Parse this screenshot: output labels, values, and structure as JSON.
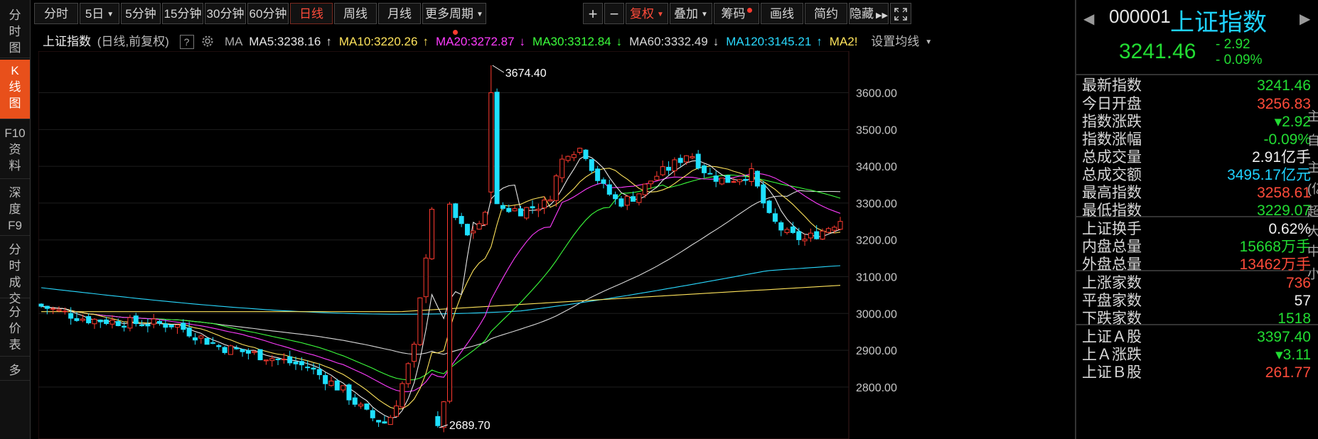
{
  "leftnav": [
    {
      "label": [
        "分",
        "时",
        "图"
      ],
      "active": false
    },
    {
      "label": [
        "K",
        "线",
        "图"
      ],
      "active": true
    },
    {
      "label": [
        "F10",
        "资",
        "料"
      ],
      "active": false
    },
    {
      "label": [
        "深",
        "度",
        "F9"
      ],
      "active": false
    },
    {
      "label": [
        "分",
        "时",
        "成",
        "交"
      ],
      "active": false
    },
    {
      "label": [
        "分",
        "价",
        "表"
      ],
      "active": false
    },
    {
      "label": [
        "多"
      ],
      "active": false
    }
  ],
  "toolbar": {
    "intraday": "分时",
    "five_day": "5日",
    "m5": "5分钟",
    "m15": "15分钟",
    "m30": "30分钟",
    "m60": "60分钟",
    "daily": "日线",
    "weekly": "周线",
    "monthly": "月线",
    "more_period": "更多周期",
    "plus": "+",
    "minus": "−",
    "adjust": "复权",
    "overlay": "叠加",
    "chips": "筹码",
    "draw": "画线",
    "simple": "简约",
    "hide": "隐藏",
    "fullscreen_icon": "fullscreen-icon",
    "caret_icon": "chevron-down-icon"
  },
  "legend": {
    "name": "上证指数",
    "desc": "(日线,前复权)",
    "help": "?",
    "gear_icon": "gear-icon",
    "ma": "MA",
    "items": [
      {
        "text": "MA5:3238.16",
        "arrow": "↑",
        "color": "#e8e8e8"
      },
      {
        "text": "MA10:3220.26",
        "arrow": "↑",
        "color": "#ffe45c"
      },
      {
        "text": "MA20:3272.87",
        "arrow": "↓",
        "color": "#ff3cff"
      },
      {
        "text": "MA30:3312.84",
        "arrow": "↓",
        "color": "#3cff3c"
      },
      {
        "text": "MA60:3332.49",
        "arrow": "↓",
        "color": "#d8d8d8"
      },
      {
        "text": "MA120:3145.21",
        "arrow": "↑",
        "color": "#29d9ff"
      },
      {
        "text": "MA2!",
        "arrow": "",
        "color": "#ffe45c"
      }
    ],
    "settings": "设置均线"
  },
  "chart_data": {
    "type": "candlestick",
    "y_ticks": [
      "3600.00",
      "3500.00",
      "3400.00",
      "3300.00",
      "3200.00",
      "3100.00",
      "3000.00",
      "2900.00",
      "2800.00"
    ],
    "ylim": [
      2680,
      3700
    ],
    "annotations": [
      {
        "text": "3674.40",
        "value": 3674.4
      },
      {
        "text": "2689.70",
        "value": 2689.7
      }
    ],
    "colors": {
      "up": "#ff3b30",
      "down": "#1fe0ff",
      "ma5": "#e8e8e8",
      "ma10": "#ffe45c",
      "ma20": "#ff3cff",
      "ma30": "#3cff3c",
      "ma60": "#d8d8d8",
      "ma120": "#29d9ff",
      "ma250": "#ffe45c"
    }
  },
  "right": {
    "code": "000001",
    "name": "上证指数",
    "price": "3241.46",
    "change": "- 2.92",
    "change_pct": "- 0.09%",
    "prev_icon": "triangle-left-icon",
    "next_icon": "triangle-right-icon",
    "rows": [
      {
        "k": "最新指数",
        "v": "3241.46",
        "c": "green"
      },
      {
        "k": "今日开盘",
        "v": "3256.83",
        "c": "red2"
      },
      {
        "k": "指数涨跌",
        "v": "▾2.92",
        "c": "green"
      },
      {
        "k": "指数涨幅",
        "v": "-0.09%",
        "c": "green"
      },
      {
        "k": "总成交量",
        "v": "2.91亿手",
        "c": "white"
      },
      {
        "k": "总成交额",
        "v": "3495.17亿元",
        "c": "cyan"
      },
      {
        "k": "最高指数",
        "v": "3258.61",
        "c": "red2"
      },
      {
        "k": "最低指数",
        "v": "3229.07",
        "c": "green"
      },
      {
        "k": "上证换手",
        "v": "0.62%",
        "c": "white"
      },
      {
        "k": "内盘总量",
        "v": "15668万手",
        "c": "green"
      },
      {
        "k": "外盘总量",
        "v": "13462万手",
        "c": "red2"
      },
      {
        "k": "上涨家数",
        "v": "736",
        "c": "red2"
      },
      {
        "k": "平盘家数",
        "v": "57",
        "c": "white"
      },
      {
        "k": "下跌家数",
        "v": "1518",
        "c": "green"
      },
      {
        "k": "上证Ａ股",
        "v": "3397.40",
        "c": "green"
      },
      {
        "k": "上Ａ涨跌",
        "v": "▾3.11",
        "c": "green"
      },
      {
        "k": "上证Ｂ股",
        "v": "261.77",
        "c": "red2"
      }
    ],
    "edge": [
      "主",
      "自",
      "主",
      "(亿",
      "超",
      "大",
      "中",
      "小"
    ]
  }
}
